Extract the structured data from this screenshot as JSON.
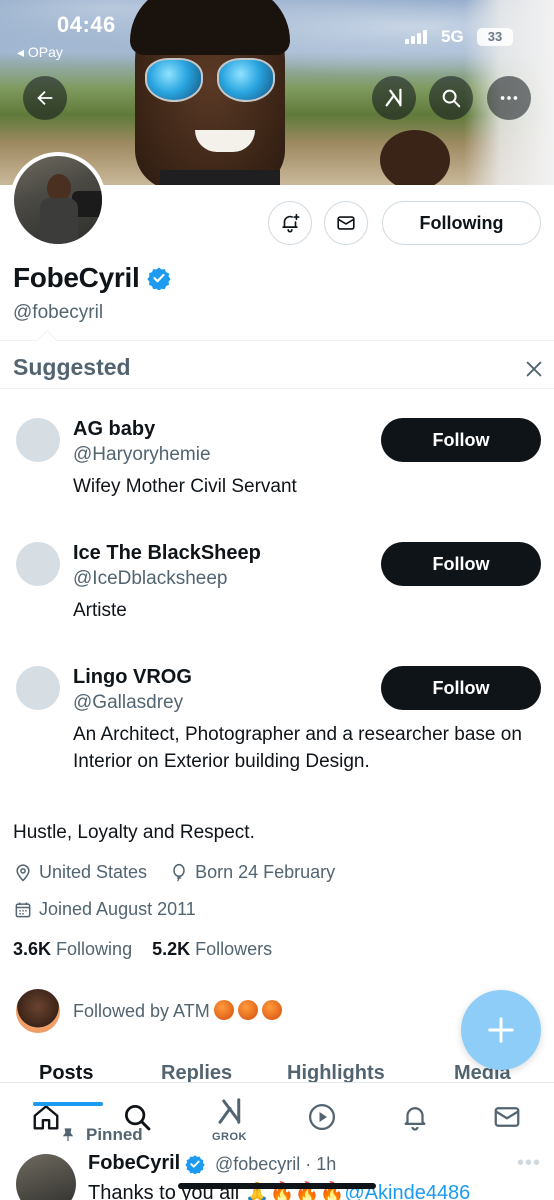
{
  "status_bar": {
    "time": "04:46",
    "back_app": "◂ OPay",
    "network": "5G",
    "battery": "33"
  },
  "profile": {
    "name": "FobeCyril",
    "handle": "@fobecyril",
    "following_button": "Following",
    "bio": "Hustle, Loyalty and Respect.",
    "location": "United States",
    "birthday": "Born 24 February",
    "joined": "Joined August 2011",
    "following_count": "3.6K",
    "following_label": "Following",
    "followers_count": "5.2K",
    "followers_label": "Followers",
    "followed_by": "Followed by ATM"
  },
  "suggested": {
    "title": "Suggested",
    "items": [
      {
        "name": "AG baby",
        "handle": "@Haryoryhemie",
        "bio": "Wifey Mother Civil Servant",
        "button": "Follow"
      },
      {
        "name": "Ice The BlackSheep",
        "handle": "@IceDblacksheep",
        "bio": "Artiste",
        "button": "Follow"
      },
      {
        "name": "Lingo VROG",
        "handle": "@Gallasdrey",
        "bio": "An Architect, Photographer and a researcher base on Interior on Exterior building Design.",
        "button": "Follow"
      }
    ]
  },
  "tabs": [
    "Posts",
    "Replies",
    "Highlights",
    "Media"
  ],
  "nav": {
    "grok_label": "GROK"
  },
  "pinned_post": {
    "pinned_label": "Pinned",
    "name": "FobeCyril",
    "meta": "@fobecyril · 1h",
    "text_prefix": "Thanks to you all 🙏🔥🔥🔥",
    "mention": "@Akinde4486"
  },
  "colors": {
    "accent": "#1d9bf0",
    "fab": "#8ecdf8",
    "follow_button": "#0f1419",
    "muted_text": "#536471"
  },
  "icons": [
    "back-arrow-icon",
    "grok-icon",
    "search-icon",
    "more-icon",
    "notification-bell-plus-icon",
    "mail-icon",
    "verified-badge-icon",
    "close-icon",
    "location-pin-icon",
    "balloon-icon",
    "calendar-icon",
    "plus-icon",
    "home-icon",
    "play-icon",
    "bell-icon",
    "pin-icon"
  ]
}
